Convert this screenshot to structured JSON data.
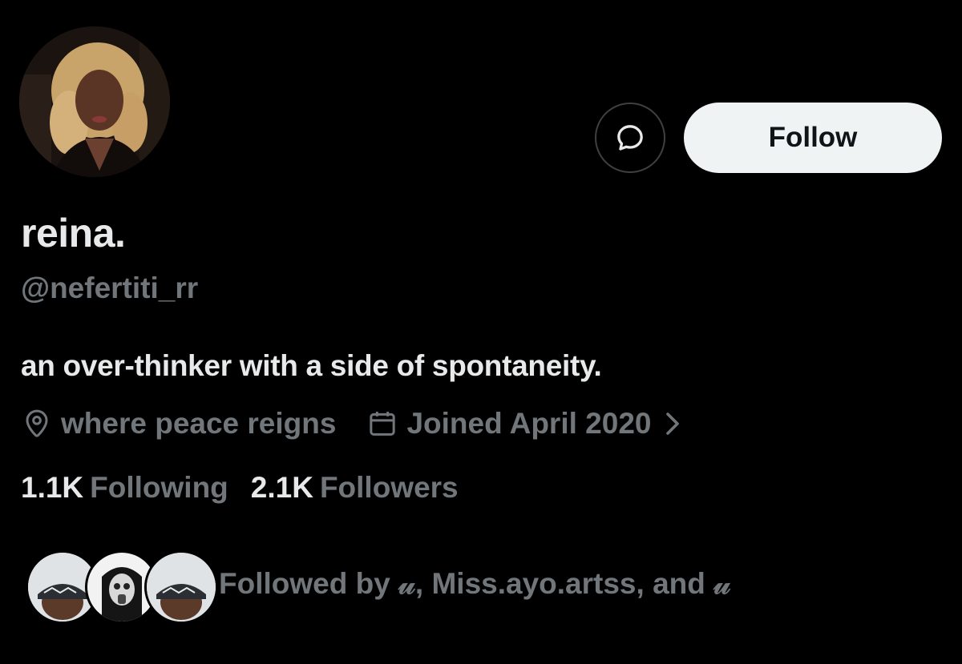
{
  "profile": {
    "display_name": "reina.",
    "handle": "@nefertiti_rr",
    "bio": "an over-thinker with a side of spontaneity.",
    "location": "where peace reigns",
    "joined": "Joined April 2020"
  },
  "actions": {
    "follow_label": "Follow",
    "message_icon": "message-bubble-icon"
  },
  "stats": {
    "following_count": "1.1K",
    "following_label": "Following",
    "followers_count": "2.1K",
    "followers_label": "Followers"
  },
  "followed_by": {
    "text": "Followed by 𝓊, Miss.ayo.artss, and 𝓊"
  },
  "icons": {
    "location": "map-pin-icon",
    "calendar": "calendar-icon",
    "chevron": "chevron-right-icon"
  },
  "colors": {
    "background": "#000000",
    "primary_text": "#e7e9ea",
    "secondary_text": "#71767b",
    "follow_button_bg": "#eff3f4",
    "follow_button_text": "#0f1419",
    "border": "#3e4144"
  }
}
